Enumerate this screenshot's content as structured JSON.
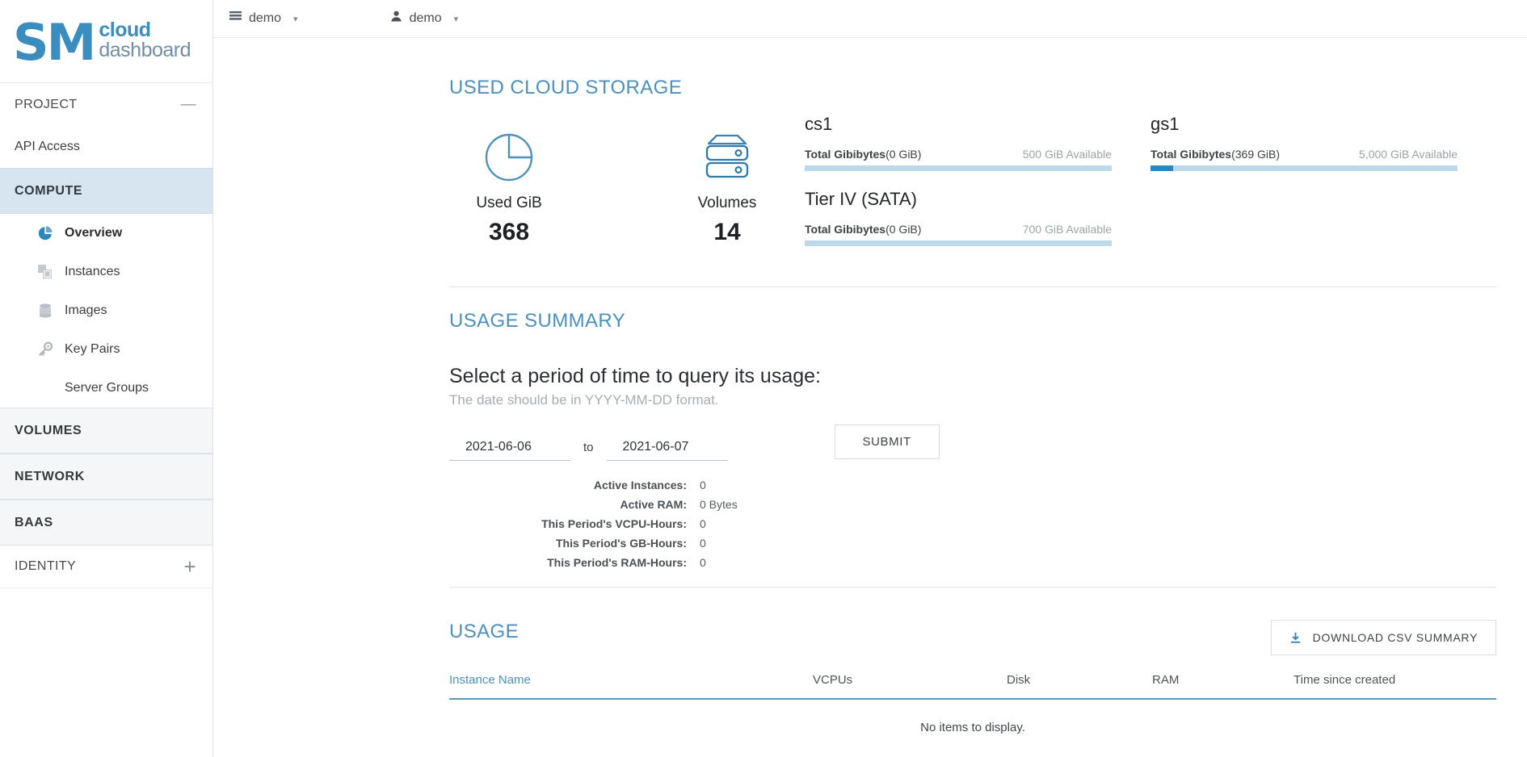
{
  "brand": {
    "mark": "SM",
    "line1": "cloud",
    "line2": "dashboard",
    "color": "#3b8dbd"
  },
  "topbar": {
    "project_icon": "list-icon",
    "project_name": "demo",
    "user_icon": "user-icon",
    "user_name": "demo",
    "caret": "▾"
  },
  "sidebar": {
    "project_label": "PROJECT",
    "collapse_glyph": "—",
    "api_access": "API Access",
    "groups": [
      {
        "label": "COMPUTE",
        "active": true
      },
      {
        "label": "VOLUMES",
        "active": false
      },
      {
        "label": "NETWORK",
        "active": false
      },
      {
        "label": "BAAS",
        "active": false
      }
    ],
    "compute_items": [
      {
        "label": "Overview",
        "icon": "pie-chart-icon",
        "current": true
      },
      {
        "label": "Instances",
        "icon": "instances-icon",
        "current": false
      },
      {
        "label": "Images",
        "icon": "database-icon",
        "current": false
      },
      {
        "label": "Key Pairs",
        "icon": "key-icon",
        "current": false
      },
      {
        "label": "Server Groups",
        "icon": "none",
        "current": false
      }
    ],
    "identity_label": "IDENTITY",
    "identity_plus": "+"
  },
  "storage": {
    "title": "USED CLOUD STORAGE",
    "stats": [
      {
        "icon": "pie-chart-icon",
        "label": "Used GiB",
        "value": "368"
      },
      {
        "icon": "volumes-icon",
        "label": "Volumes",
        "value": "14"
      }
    ],
    "quotas": [
      {
        "name": "cs1",
        "metric": "Total Gibibytes",
        "used": "(0 GiB)",
        "available": "500 GiB Available",
        "percent": 0
      },
      {
        "name": "gs1",
        "metric": "Total Gibibytes",
        "used": "(369 GiB)",
        "available": "5,000 GiB Available",
        "percent": 7.4
      },
      {
        "name": "Tier IV (SATA)",
        "metric": "Total Gibibytes",
        "used": "(0 GiB)",
        "available": "700 GiB Available",
        "percent": 0
      }
    ]
  },
  "usage_summary": {
    "title": "USAGE SUMMARY",
    "period_heading": "Select a period of time to query its usage:",
    "period_hint": "The date should be in YYYY-MM-DD format.",
    "date_from": "2021-06-06",
    "date_to": "2021-06-07",
    "to_label": "to",
    "submit_label": "SUBMIT",
    "rows": [
      {
        "key": "Active Instances:",
        "value": "0"
      },
      {
        "key": "Active RAM:",
        "value": "0 Bytes"
      },
      {
        "key": "This Period's VCPU-Hours:",
        "value": "0"
      },
      {
        "key": "This Period's GB-Hours:",
        "value": "0"
      },
      {
        "key": "This Period's RAM-Hours:",
        "value": "0"
      }
    ]
  },
  "usage": {
    "title": "USAGE",
    "download_label": "DOWNLOAD CSV SUMMARY",
    "download_icon": "download-icon",
    "columns": [
      "Instance Name",
      "VCPUs",
      "Disk",
      "RAM",
      "Time since created"
    ],
    "empty_text": "No items to display."
  }
}
